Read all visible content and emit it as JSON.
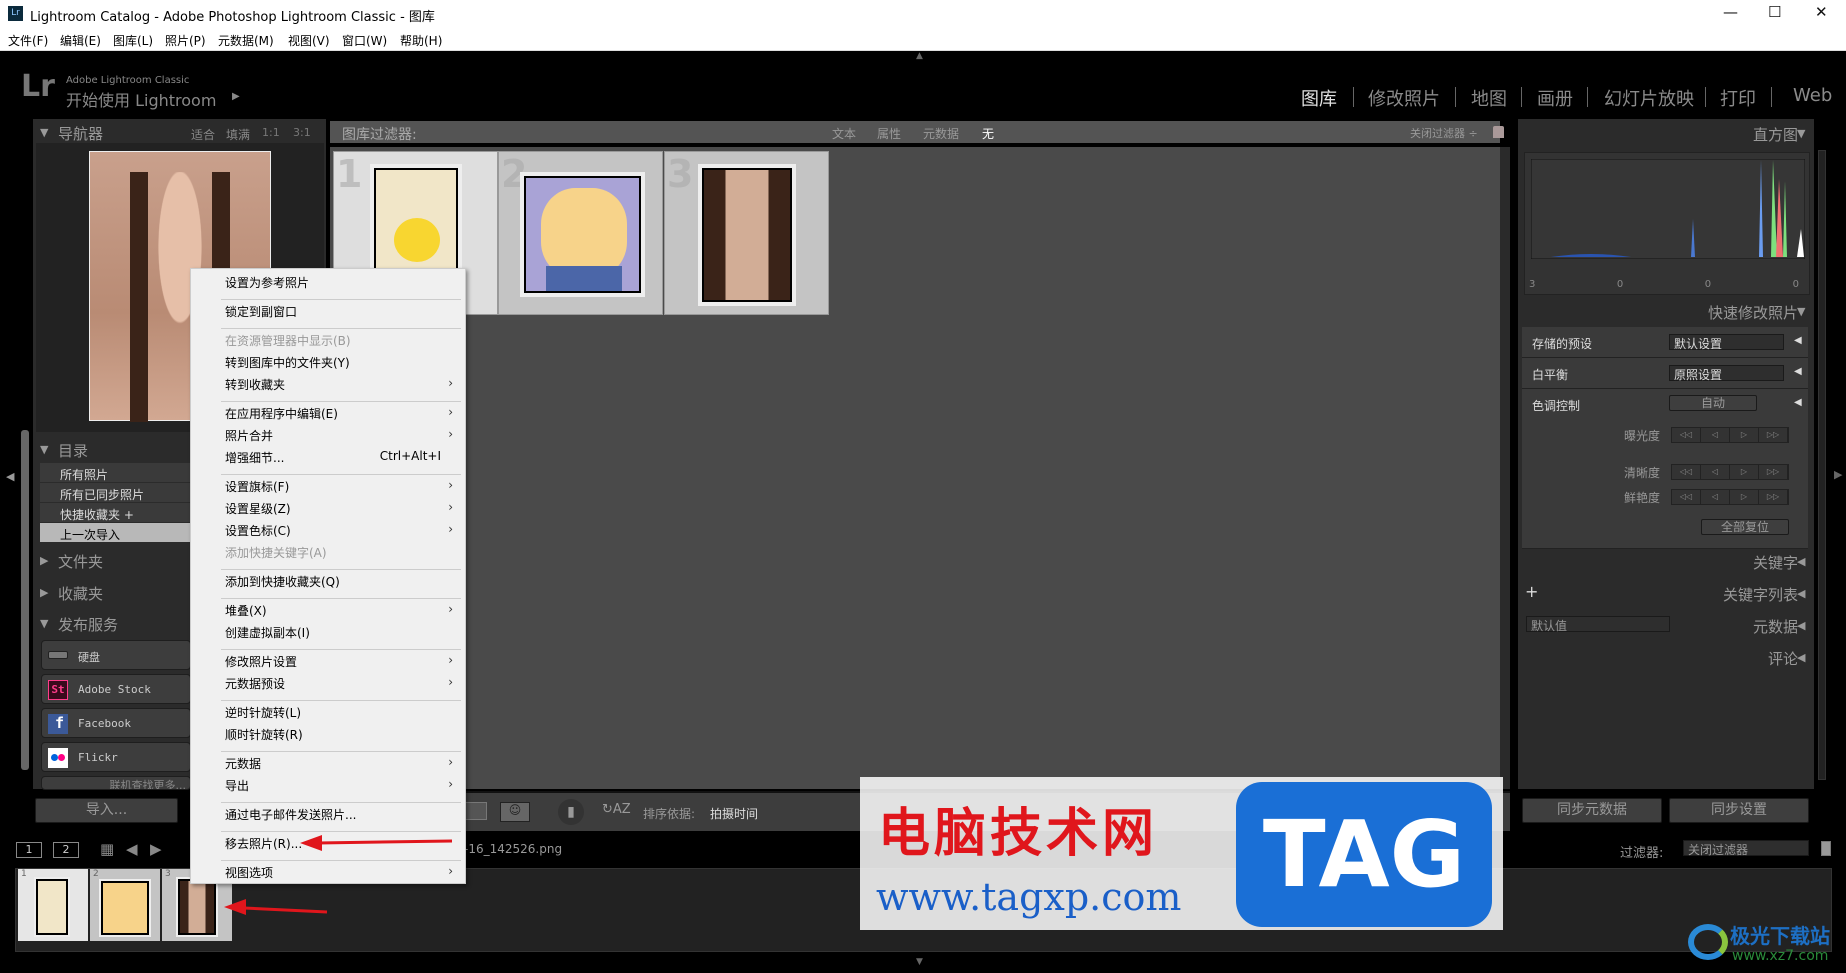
{
  "window": {
    "title": "Lightroom Catalog - Adobe Photoshop Lightroom Classic - 图库",
    "min": "—",
    "max": "☐",
    "close": "✕"
  },
  "menubar": [
    "文件(F)",
    "编辑(E)",
    "图库(L)",
    "照片(P)",
    "元数据(M)",
    "视图(V)",
    "窗口(W)",
    "帮助(H)"
  ],
  "brand": {
    "logo": "Lr",
    "product": "Adobe Lightroom Classic",
    "subtitle": "开始使用 Lightroom",
    "arrow": "▶"
  },
  "modules": [
    "图库",
    "修改照片",
    "地图",
    "画册",
    "幻灯片放映",
    "打印",
    "Web"
  ],
  "navigator": {
    "title": "导航器",
    "zoom": [
      "适合",
      "填满",
      "1:1",
      "3:1"
    ]
  },
  "catalog": {
    "title": "目录",
    "items": [
      "所有照片",
      "所有已同步照片",
      "快捷收藏夹 +",
      "上一次导入"
    ]
  },
  "folders": {
    "title": "文件夹"
  },
  "collections": {
    "title": "收藏夹"
  },
  "publish": {
    "title": "发布服务",
    "items": [
      "硬盘",
      "Adobe Stock",
      "Facebook",
      "Flickr"
    ],
    "more": "联机查找更多..."
  },
  "import_label": "导入...",
  "filterbar": {
    "title": "图库过滤器:",
    "tabs": [
      "文本",
      "属性",
      "元数据",
      "无"
    ],
    "preset": "关闭过滤器 ÷"
  },
  "grid": {
    "cells": [
      "1",
      "2",
      "3"
    ]
  },
  "toolbar": {
    "sort_label": "排序依据:",
    "sort_value": "拍摄时间"
  },
  "filmstrip": {
    "pages": [
      "1",
      "2"
    ],
    "path": "-16_142526.png",
    "filter_label": "过滤器:",
    "filter_value": "关闭过滤器",
    "thumbs": [
      "1",
      "2",
      "3"
    ]
  },
  "histogram": {
    "title": "直方图",
    "counts": [
      "3",
      "0",
      "0",
      "0"
    ]
  },
  "quick_develop": {
    "title": "快速修改照片",
    "preset_label": "存储的预设",
    "preset_value": "默认设置",
    "wb_label": "白平衡",
    "wb_value": "原照设置",
    "tone_label": "色调控制",
    "auto": "自动",
    "exposure": "曝光度",
    "clarity": "清晰度",
    "vibrance": "鲜艳度",
    "reset": "全部复位"
  },
  "right_sections": {
    "keywords": "关键字",
    "keyword_list": "关键字列表",
    "metadata": "元数据",
    "metadata_preset": "默认值",
    "comments": "评论",
    "plus": "+"
  },
  "sync": {
    "metadata": "同步元数据",
    "settings": "同步设置"
  },
  "context_menu": [
    {
      "label": "设置为参考照片"
    },
    {
      "sep": true
    },
    {
      "label": "锁定到副窗口"
    },
    {
      "sep": true
    },
    {
      "label": "在资源管理器中显示(B)",
      "disabled": true
    },
    {
      "label": "转到图库中的文件夹(Y)"
    },
    {
      "label": "转到收藏夹",
      "sub": true
    },
    {
      "sep": true
    },
    {
      "label": "在应用程序中编辑(E)",
      "sub": true
    },
    {
      "label": "照片合并",
      "sub": true
    },
    {
      "label": "增强细节...",
      "shortcut": "Ctrl+Alt+I"
    },
    {
      "sep": true
    },
    {
      "label": "设置旗标(F)",
      "sub": true
    },
    {
      "label": "设置星级(Z)",
      "sub": true
    },
    {
      "label": "设置色标(C)",
      "sub": true
    },
    {
      "label": "添加快捷关键字(A)",
      "disabled": true
    },
    {
      "sep": true
    },
    {
      "label": "添加到快捷收藏夹(Q)"
    },
    {
      "sep": true
    },
    {
      "label": "堆叠(X)",
      "sub": true
    },
    {
      "label": "创建虚拟副本(I)"
    },
    {
      "sep": true
    },
    {
      "label": "修改照片设置",
      "sub": true
    },
    {
      "label": "元数据预设",
      "sub": true
    },
    {
      "sep": true
    },
    {
      "label": "逆时针旋转(L)"
    },
    {
      "label": "顺时针旋转(R)"
    },
    {
      "sep": true
    },
    {
      "label": "元数据",
      "sub": true
    },
    {
      "label": "导出",
      "sub": true
    },
    {
      "sep": true
    },
    {
      "label": "通过电子邮件发送照片..."
    },
    {
      "sep": true
    },
    {
      "label": "移去照片(R)..."
    },
    {
      "sep": true
    },
    {
      "label": "视图选项",
      "sub": true
    }
  ],
  "watermark": {
    "cn": "电脑技术网",
    "url": "www.tagxp.com",
    "tag": "TAG",
    "site2": "极光下载站",
    "url2": "www.xz7.com"
  },
  "colors": {
    "accent_red": "#e0161c",
    "tag_blue": "#1a6fd6",
    "panel": "#2b2b2b",
    "grid_bg": "#4a4a4a"
  }
}
